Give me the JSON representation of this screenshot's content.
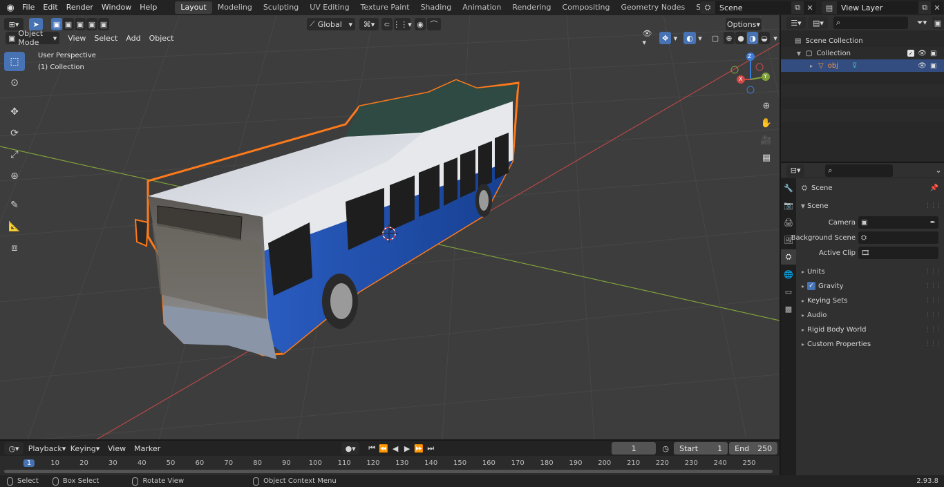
{
  "topbar": {
    "menus": [
      "File",
      "Edit",
      "Render",
      "Window",
      "Help"
    ],
    "workspaces": [
      "Layout",
      "Modeling",
      "Sculpting",
      "UV Editing",
      "Texture Paint",
      "Shading",
      "Animation",
      "Rendering",
      "Compositing",
      "Geometry Nodes",
      "Scripting"
    ],
    "active_workspace": "Layout",
    "scene_name": "Scene",
    "view_layer": "View Layer"
  },
  "viewport": {
    "mode": "Object Mode",
    "menus": [
      "View",
      "Select",
      "Add",
      "Object"
    ],
    "orientation": "Global",
    "options_label": "Options",
    "overlay_title": "User Perspective",
    "overlay_collection": "(1) Collection",
    "gizmo": {
      "x": "X",
      "y": "Y",
      "z": "Z"
    }
  },
  "timeline": {
    "menus": [
      "Playback",
      "Keying",
      "View",
      "Marker"
    ],
    "current_frame": "1",
    "start_label": "Start",
    "start_value": "1",
    "end_label": "End",
    "end_value": "250",
    "ticks": [
      "1",
      "10",
      "20",
      "30",
      "40",
      "50",
      "60",
      "70",
      "80",
      "90",
      "100",
      "110",
      "120",
      "130",
      "140",
      "150",
      "160",
      "170",
      "180",
      "190",
      "200",
      "210",
      "220",
      "230",
      "240",
      "250"
    ]
  },
  "statusbar": {
    "select": "Select",
    "box_select": "Box Select",
    "rotate_view": "Rotate View",
    "context_menu": "Object Context Menu",
    "version": "2.93.8"
  },
  "outliner": {
    "scene_collection": "Scene Collection",
    "collection": "Collection",
    "object": "obj"
  },
  "properties": {
    "context": "Scene",
    "panel_title": "Scene",
    "camera_label": "Camera",
    "background_label": "Background Scene",
    "clip_label": "Active Clip",
    "sections": [
      "Units",
      "Gravity",
      "Keying Sets",
      "Audio",
      "Rigid Body World",
      "Custom Properties"
    ]
  },
  "colors": {
    "accent": "#4772b3",
    "selection_outline": "#ff7a1a",
    "bus_blue": "#1f4fa8",
    "grid_x": "#b84848",
    "grid_y": "#7fa03a"
  }
}
